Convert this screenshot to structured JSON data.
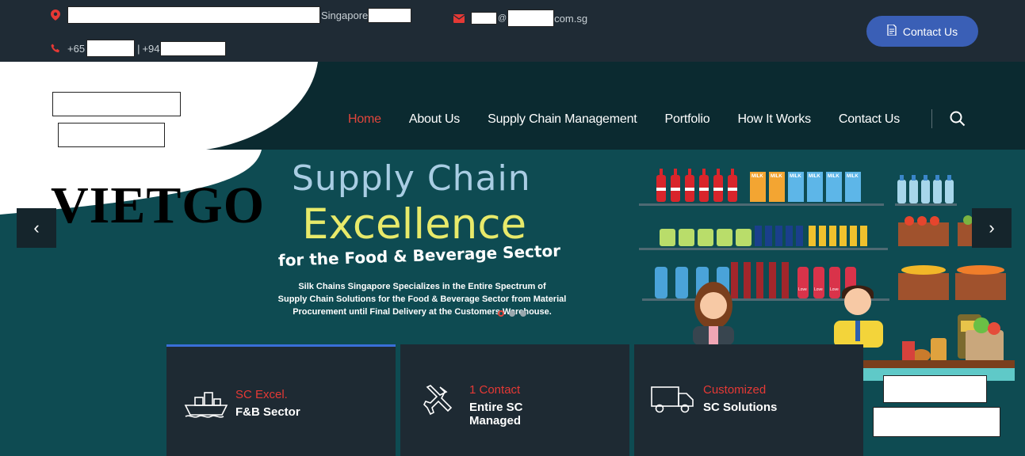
{
  "topbar": {
    "address_suffix": "Singapore",
    "email_suffix": "com.sg",
    "phone_prefix_1": "+65",
    "phone_sep": "|",
    "phone_prefix_2": "+94",
    "contact_button": "Contact Us"
  },
  "nav": {
    "items": [
      "Home",
      "About Us",
      "Supply Chain Management",
      "Portfolio",
      "How It Works",
      "Contact Us"
    ],
    "active_index": 0
  },
  "logo_text": "VIETGO",
  "hero": {
    "title_line1": "Supply Chain",
    "title_line2": "Excellence",
    "title_line3": "for the Food & Beverage Sector",
    "description_line1": "Silk Chains Singapore Specializes in the Entire Spectrum of",
    "description_line2": "Supply Chain Solutions for the Food & Beverage Sector from Material",
    "description_line3": "Procurement until Final Delivery at the Customers Warehouse.",
    "prev_arrow": "‹",
    "next_arrow": "›",
    "slides_total": 3,
    "slide_active": 1
  },
  "illustration": {
    "milk_label": "MILK",
    "love_label": "Love"
  },
  "cards": [
    {
      "title": "SC Excel.",
      "subtitle": "F&B Sector",
      "icon": "ship-icon"
    },
    {
      "title": "1 Contact",
      "subtitle": "Entire SC\nManaged",
      "icon": "plane-icon"
    },
    {
      "title": "Customized",
      "subtitle": "SC Solutions",
      "icon": "truck-icon"
    }
  ],
  "colors": {
    "accent_red": "#e53935",
    "button_blue": "#3a5fb6",
    "topbar_bg": "#1f2b35",
    "hero_bg": "#0e4b52",
    "title_blue": "#a9cde3",
    "title_yellow": "#e8ea6a"
  }
}
